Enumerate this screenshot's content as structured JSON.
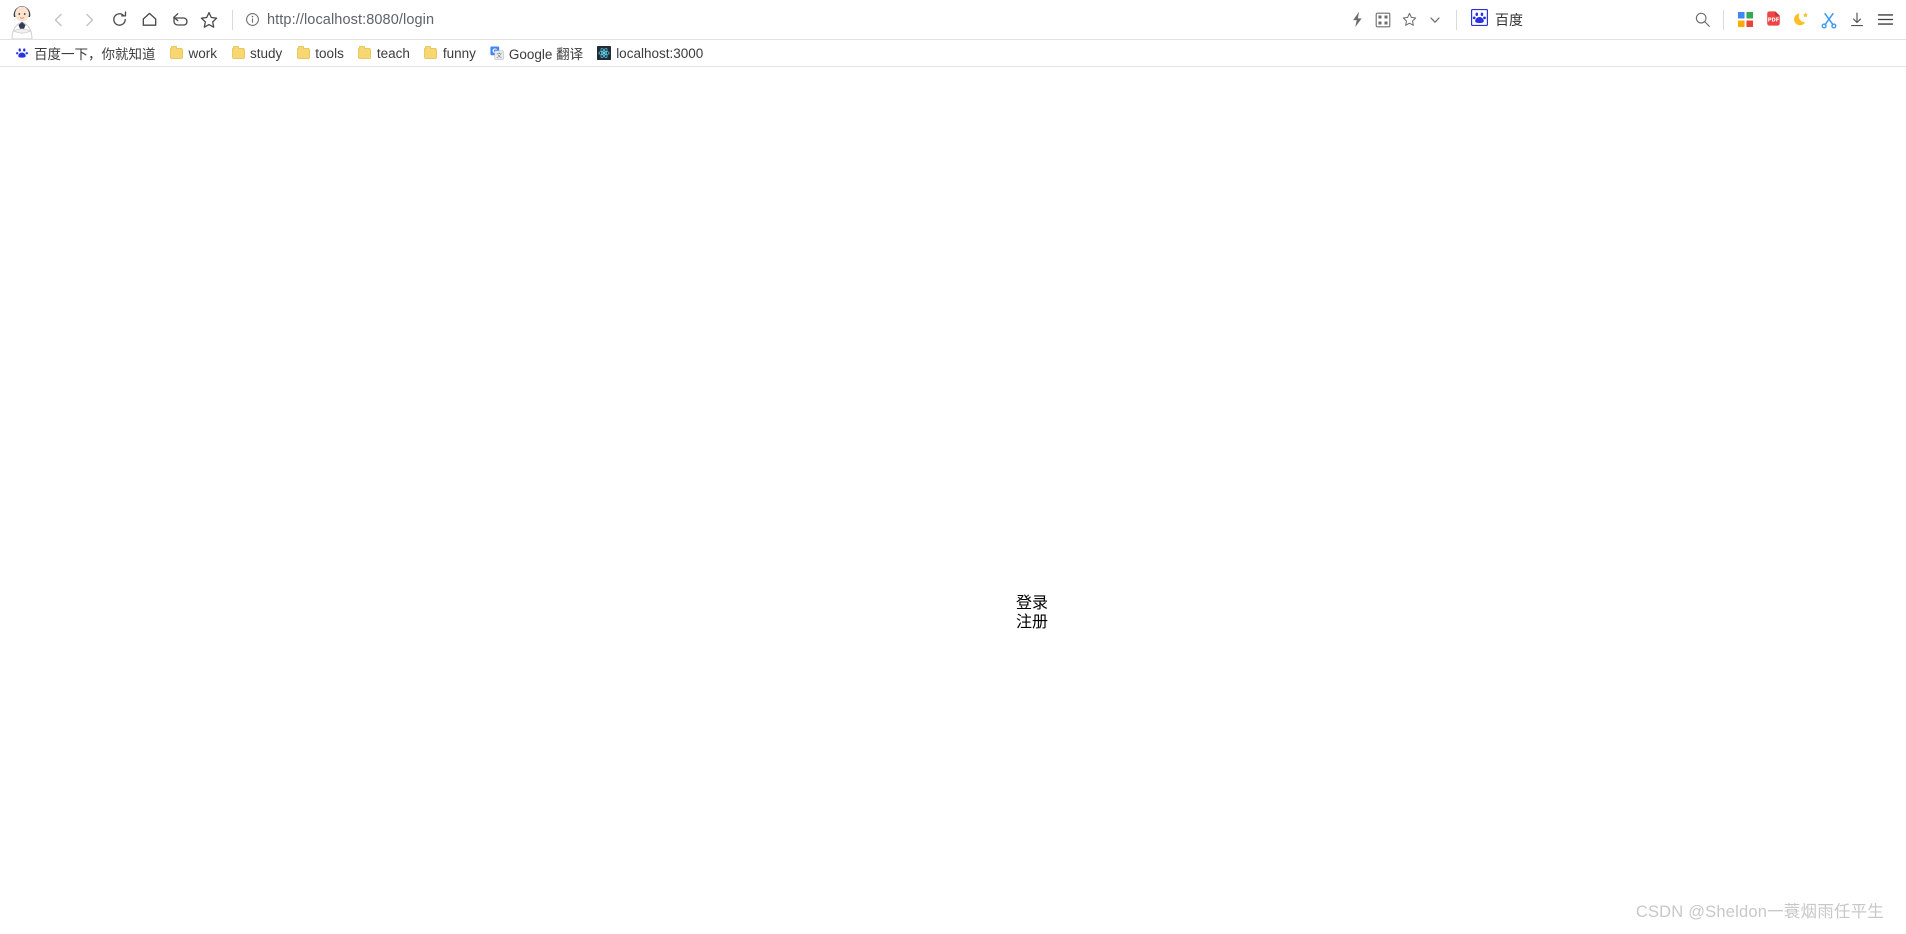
{
  "browser": {
    "avatar_name": "user-avatar-cartoon",
    "nav": [
      {
        "name": "back-icon",
        "title": "Back",
        "disabled": true
      },
      {
        "name": "forward-icon",
        "title": "Forward",
        "disabled": true
      },
      {
        "name": "reload-icon",
        "title": "Reload",
        "disabled": false
      },
      {
        "name": "home-icon",
        "title": "Home",
        "disabled": false
      },
      {
        "name": "undo-icon",
        "title": "Undo",
        "disabled": false
      },
      {
        "name": "star-icon",
        "title": "Bookmark",
        "disabled": false
      }
    ],
    "address": {
      "info_icon": "info-circle-icon",
      "url": "http://localhost:8080/login"
    },
    "right_icons_inline": [
      {
        "name": "lightning-icon",
        "title": "Turbo"
      },
      {
        "name": "qrcode-icon",
        "title": "QR code"
      },
      {
        "name": "star-outline-icon",
        "title": "Favorites"
      },
      {
        "name": "chevron-down-icon",
        "title": "More"
      }
    ],
    "search_engine": {
      "icon": "baidu-paw-icon",
      "label": "百度"
    },
    "right_icons_tail": [
      {
        "name": "search-icon",
        "title": "Search"
      },
      {
        "name": "apps-grid-icon",
        "title": "Apps"
      },
      {
        "name": "pdf-icon",
        "title": "PDF tools"
      },
      {
        "name": "night-mode-icon",
        "title": "Night mode"
      },
      {
        "name": "screenshot-scissors-icon",
        "title": "Screenshot"
      },
      {
        "name": "download-icon",
        "title": "Downloads"
      },
      {
        "name": "menu-icon",
        "title": "Menu"
      }
    ]
  },
  "bookmarks": [
    {
      "label": "百度一下，你就知道",
      "icon": "baidu-paw-icon"
    },
    {
      "label": "work",
      "icon": "folder-icon"
    },
    {
      "label": "study",
      "icon": "folder-icon"
    },
    {
      "label": "tools",
      "icon": "folder-icon"
    },
    {
      "label": "teach",
      "icon": "folder-icon"
    },
    {
      "label": "funny",
      "icon": "folder-icon"
    },
    {
      "label": "Google 翻译",
      "icon": "google-translate-icon"
    },
    {
      "label": "localhost:3000",
      "icon": "react-icon"
    }
  ],
  "page": {
    "links": [
      {
        "label": "登录"
      },
      {
        "label": "注册"
      }
    ],
    "watermark": "CSDN @Sheldon一蓑烟雨任平生"
  },
  "colors": {
    "accent_blue": "#2932e1",
    "folder_yellow": "#f7d774",
    "url_text": "#5f6368",
    "watermark": "#c8c8c8"
  }
}
